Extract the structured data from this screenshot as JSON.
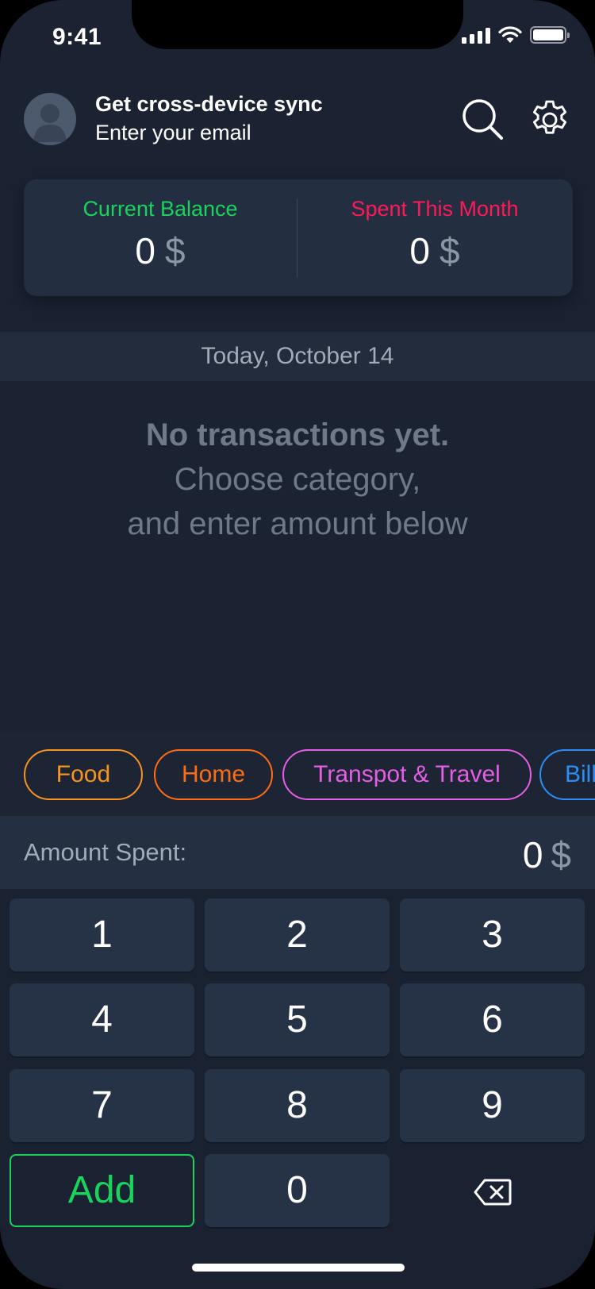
{
  "status_bar": {
    "time": "9:41"
  },
  "header": {
    "title": "Get cross-device sync",
    "subtitle": "Enter your email"
  },
  "balance": {
    "current_label": "Current Balance",
    "current_value": "0",
    "current_currency": "$",
    "spent_label": "Spent This Month",
    "spent_value": "0",
    "spent_currency": "$"
  },
  "colors": {
    "positive": "#18d35c",
    "negative": "#ff1a57",
    "food": "#f7941d",
    "home": "#ff6d12",
    "travel": "#e55ee6",
    "bills": "#2b8ef7"
  },
  "date_header": "Today, October 14",
  "empty_state": {
    "line1": "No transactions yet.",
    "line2": "Choose category,",
    "line3": "and enter amount below"
  },
  "categories": [
    {
      "label": "Food"
    },
    {
      "label": "Home"
    },
    {
      "label": "Transpot & Travel"
    },
    {
      "label": "Bill"
    }
  ],
  "amount": {
    "label": "Amount Spent:",
    "value": "0",
    "currency": "$"
  },
  "keypad": {
    "keys": [
      "1",
      "2",
      "3",
      "4",
      "5",
      "6",
      "7",
      "8",
      "9"
    ],
    "add_label": "Add",
    "zero": "0"
  }
}
